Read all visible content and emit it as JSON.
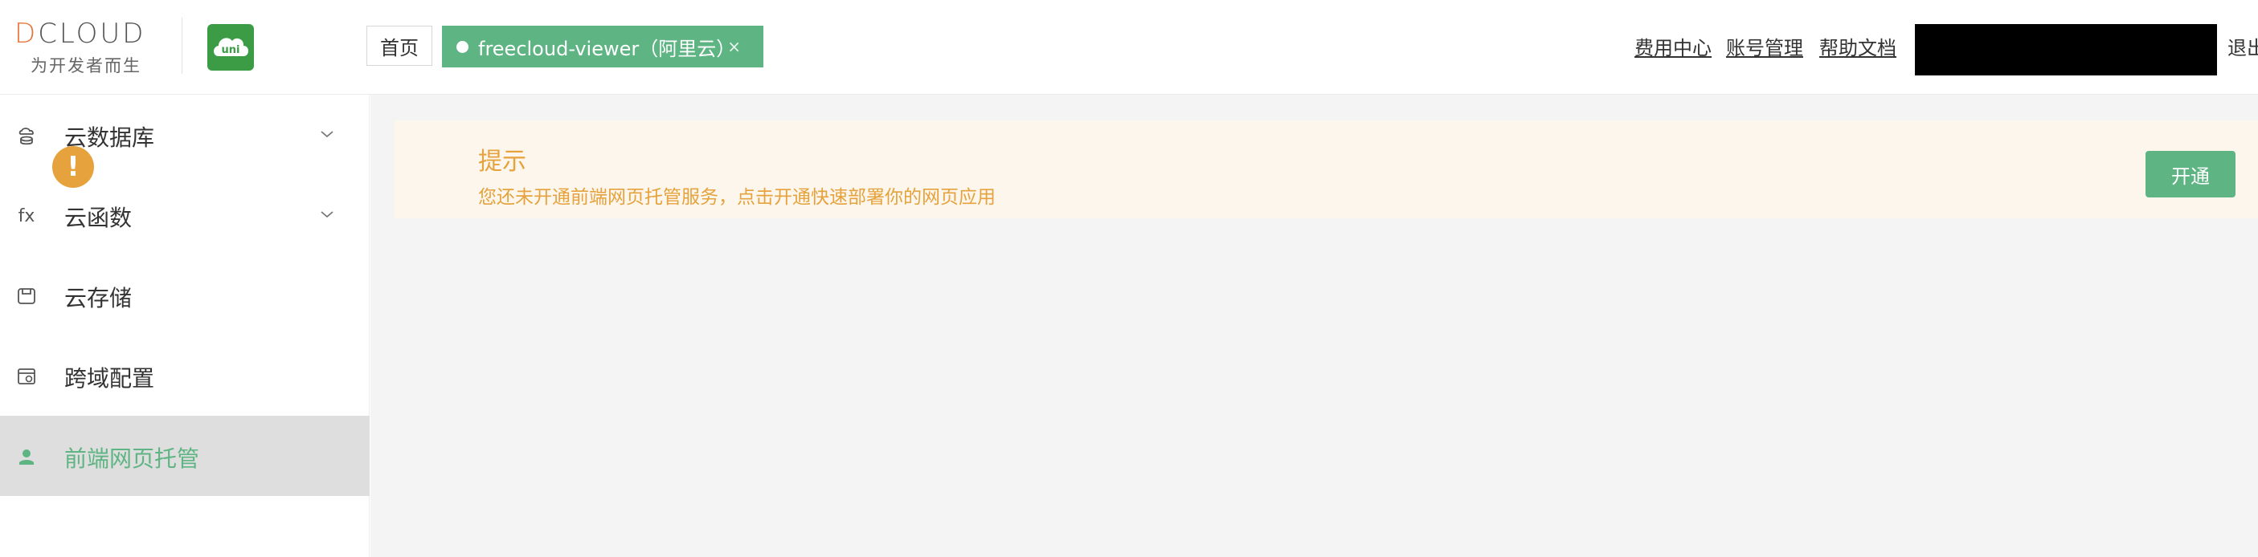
{
  "logo": {
    "brand": "DCLOUD",
    "brand_letter": "D",
    "brand_rest": "CLOUD",
    "tagline": "为开发者而生",
    "product_icon": "uni-cloud-icon",
    "product_text": "uni"
  },
  "tabs": {
    "home_label": "首页",
    "active_label": "freecloud-viewer（阿里云）",
    "close_glyph": "×"
  },
  "top_nav": {
    "links": [
      "费用中心",
      "账号管理",
      "帮助文档"
    ],
    "logout": "退出"
  },
  "sidebar": {
    "items": [
      {
        "label": "云数据库",
        "icon": "database-icon",
        "has_submenu": true
      },
      {
        "label": "云函数",
        "icon": "function-icon",
        "icon_text": "fx",
        "has_submenu": true
      },
      {
        "label": "云存储",
        "icon": "storage-icon",
        "has_submenu": false
      },
      {
        "label": "跨域配置",
        "icon": "cors-config-icon",
        "has_submenu": false
      },
      {
        "label": "前端网页托管",
        "icon": "web-hosting-icon",
        "has_submenu": false,
        "active": true
      }
    ]
  },
  "alert": {
    "title": "提示",
    "description": "您还未开通前端网页托管服务，点击开通快速部署你的网页应用",
    "icon_glyph": "!",
    "button_label": "开通"
  },
  "colors": {
    "accent_green": "#5eb483",
    "warning_orange": "#e6a23c",
    "warning_bg": "#fdf6ec"
  }
}
